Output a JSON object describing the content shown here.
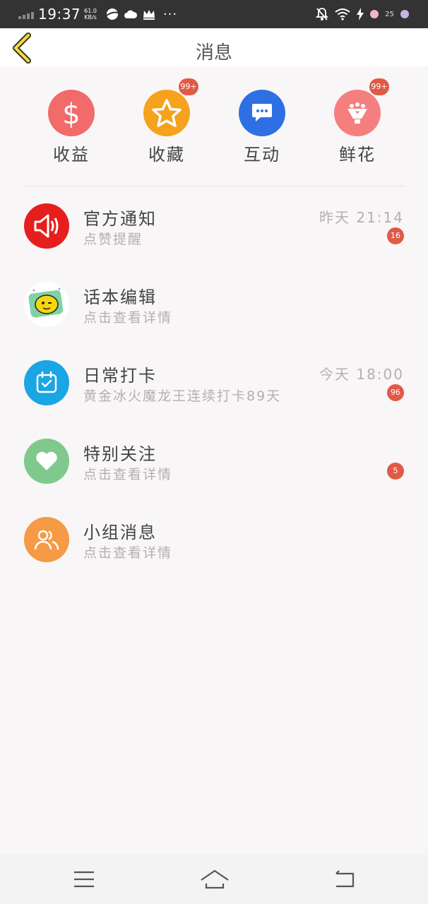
{
  "status_bar": {
    "time": "19:37",
    "net_speed_value": "61.0",
    "net_speed_unit": "KB/s",
    "more": "···",
    "notification_count": "25"
  },
  "header": {
    "title": "消息"
  },
  "categories": [
    {
      "label": "收益",
      "icon": "dollar-icon",
      "color": "#f26a6a",
      "badge": ""
    },
    {
      "label": "收藏",
      "icon": "star-icon",
      "color": "#f6a21d",
      "badge": "99+"
    },
    {
      "label": "互动",
      "icon": "chat-icon",
      "color": "#2f6fe4",
      "badge": ""
    },
    {
      "label": "鲜花",
      "icon": "flower-bouquet-icon",
      "color": "#f57f7f",
      "badge": "99+"
    }
  ],
  "messages": [
    {
      "name": "官方通知",
      "subtitle": "点赞提醒",
      "time": "昨天 21:14",
      "count": "16",
      "icon": "speaker-icon",
      "color": "#e61e1e"
    },
    {
      "name": "话本编辑",
      "subtitle": "点击查看详情",
      "time": "",
      "count": "",
      "icon": "editor-mascot-icon",
      "color": "#ffffff"
    },
    {
      "name": "日常打卡",
      "subtitle": "黄金冰火魔龙王连续打卡89天",
      "time": "今天 18:00",
      "count": "96",
      "icon": "calendar-check-icon",
      "color": "#1aa5e4"
    },
    {
      "name": "特别关注",
      "subtitle": "点击查看详情",
      "time": "",
      "count": "5",
      "icon": "heart-icon",
      "color": "#7fc98d"
    },
    {
      "name": "小组消息",
      "subtitle": "点击查看详情",
      "time": "",
      "count": "",
      "icon": "group-icon",
      "color": "#f59a45"
    }
  ],
  "nav": {
    "menu_icon": "menu-icon",
    "home_icon": "home-icon",
    "back_icon": "back-icon"
  }
}
